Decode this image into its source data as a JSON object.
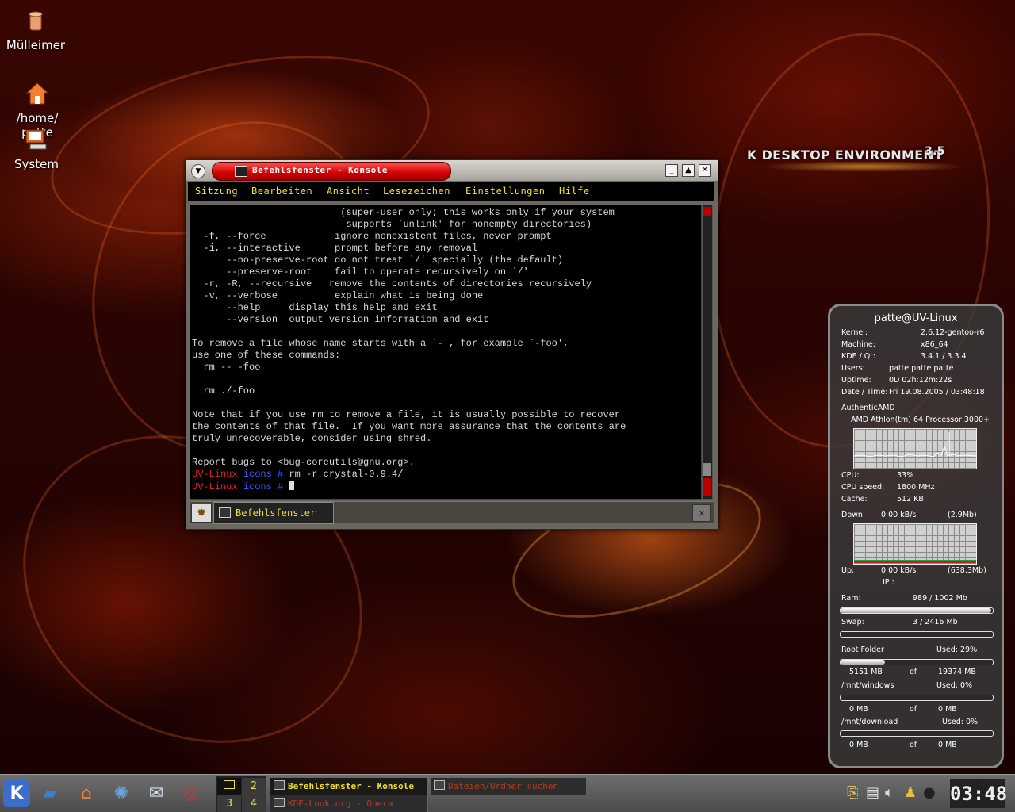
{
  "desktop": {
    "icons": [
      {
        "label": "Mülleimer"
      },
      {
        "label": "/home/\npatte"
      },
      {
        "label": "System"
      }
    ],
    "brand": {
      "text": "K DESKTOP ENVIRONMENT",
      "version": "3.5"
    }
  },
  "konsole": {
    "title": "Befehlsfenster - Konsole",
    "menu": [
      "Sitzung",
      "Bearbeiten",
      "Ansicht",
      "Lesezeichen",
      "Einstellungen",
      "Hilfe"
    ],
    "output_lines": [
      "                          (super-user only; this works only if your system",
      "                           supports `unlink' for nonempty directories)",
      "  -f, --force            ignore nonexistent files, never prompt",
      "  -i, --interactive      prompt before any removal",
      "      --no-preserve-root do not treat `/' specially (the default)",
      "      --preserve-root    fail to operate recursively on `/'",
      "  -r, -R, --recursive   remove the contents of directories recursively",
      "  -v, --verbose          explain what is being done",
      "      --help     display this help and exit",
      "      --version  output version information and exit",
      "",
      "To remove a file whose name starts with a `-', for example `-foo',",
      "use one of these commands:",
      "  rm -- -foo",
      "",
      "  rm ./-foo",
      "",
      "Note that if you use rm to remove a file, it is usually possible to recover",
      "the contents of that file.  If you want more assurance that the contents are",
      "truly unrecoverable, consider using shred.",
      "",
      "Report bugs to <bug-coreutils@gnu.org>."
    ],
    "prompt": {
      "host": "UV-Linux",
      "dir": "icons",
      "symbol": "#"
    },
    "last_command": "rm -r crystal-0.9.4/",
    "tab_label": "Befehlsfenster"
  },
  "sysmon": {
    "host": "patte@UV-Linux",
    "info": [
      {
        "label": "Kernel:",
        "value": "2.6.12-gentoo-r6"
      },
      {
        "label": "Machine:",
        "value": "x86_64"
      },
      {
        "label": "KDE / Qt:",
        "value": "3.4.1  / 3.3.4"
      },
      {
        "label": "Users:",
        "value": "patte patte patte"
      },
      {
        "label": "Uptime:",
        "value": "0D  02h:12m:22s"
      },
      {
        "label": "Date / Time:",
        "value": "Fri 19.08.2005  /  03:48:18"
      }
    ],
    "cpu_vendor": "AuthenticAMD",
    "cpu_model": "AMD Athlon(tm) 64 Processor 3000+",
    "cpu": {
      "label": "CPU:",
      "value": "33%"
    },
    "cpu_speed": {
      "label": "CPU speed:",
      "value": "1800 MHz"
    },
    "cache": {
      "label": "Cache:",
      "value": "512 KB"
    },
    "down": {
      "label": "Down:",
      "rate": "0.00 kB/s",
      "total": "(2.9Mb)"
    },
    "up": {
      "label": "Up:",
      "rate": "0.00 kB/s",
      "total": "(638.3Mb)"
    },
    "ip": "IP :",
    "ram": {
      "label": "Ram:",
      "value": "989 / 1002 Mb",
      "fraction": 0.987
    },
    "swap": {
      "label": "Swap:",
      "value": "3 / 2416 Mb",
      "fraction": 0.001
    },
    "disks": [
      {
        "name": "Root Folder",
        "used": "Used: 29%",
        "used_mb": "5151 MB",
        "of": "of",
        "total_mb": "19374 MB",
        "fraction": 0.29
      },
      {
        "name": "/mnt/windows",
        "used": "Used: 0%",
        "used_mb": "0 MB",
        "of": "of",
        "total_mb": "0 MB",
        "fraction": 0
      },
      {
        "name": "/mnt/download",
        "used": "Used: 0%",
        "used_mb": "0 MB",
        "of": "of",
        "total_mb": "0 MB",
        "fraction": 0
      }
    ]
  },
  "taskbar": {
    "pager": [
      "1",
      "2",
      "3",
      "4"
    ],
    "tasks": [
      {
        "label": "Befehlsfenster - Konsole",
        "active": true
      },
      {
        "label": "Dateien/Ordner suchen",
        "active": false
      },
      {
        "label": "KDE-Look.org - Opera",
        "active": false
      }
    ],
    "clock": "03:48"
  },
  "colors": {
    "accent_yellow": "#f0e030",
    "prompt_red": "#e82020",
    "prompt_blue": "#3a5aff",
    "title_red": "#d00000"
  }
}
